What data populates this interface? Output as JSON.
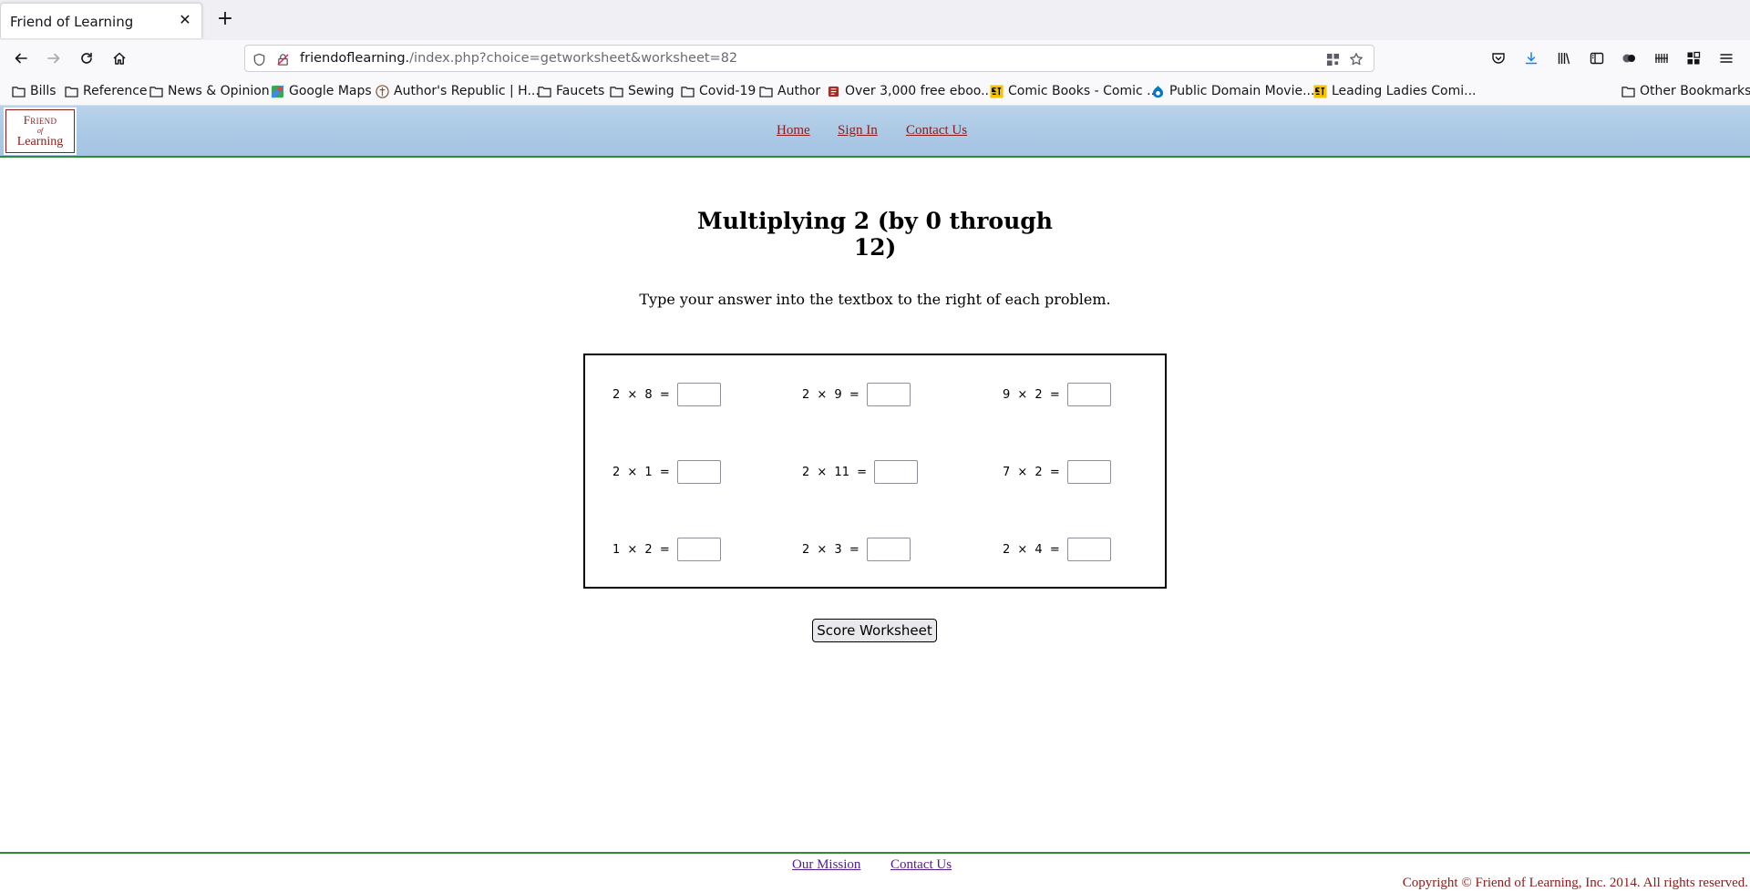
{
  "browser": {
    "tab": {
      "title": "Friend of Learning"
    },
    "url": {
      "host": "friendoflearning.",
      "path": "/index.php?choice=getworksheet&worksheet=82"
    },
    "bookmarks": [
      {
        "label": "Bills",
        "icon": "folder-icon"
      },
      {
        "label": "Reference",
        "icon": "folder-icon"
      },
      {
        "label": "News & Opinion",
        "icon": "folder-icon"
      },
      {
        "label": "Google Maps",
        "icon": "google-maps-icon"
      },
      {
        "label": "Author's Republic | H...",
        "icon": "authors-republic-icon"
      },
      {
        "label": "Faucets",
        "icon": "folder-icon"
      },
      {
        "label": "Sewing",
        "icon": "folder-icon"
      },
      {
        "label": "Covid-19",
        "icon": "folder-icon"
      },
      {
        "label": "Author",
        "icon": "folder-icon"
      },
      {
        "label": "Over 3,000 free eboo...",
        "icon": "book-icon"
      },
      {
        "label": "Comic Books - Comic ...",
        "icon": "comic-plus-icon"
      },
      {
        "label": "Public Domain Movie...",
        "icon": "drupal-icon"
      },
      {
        "label": "Leading Ladies Comi...",
        "icon": "comic-plus-icon"
      }
    ],
    "other_bookmarks": "Other Bookmarks"
  },
  "site": {
    "logo": {
      "line1": "Friend",
      "line2": "of",
      "line3": "Learning"
    },
    "nav": [
      "Home",
      "Sign In",
      "Contact Us"
    ]
  },
  "worksheet": {
    "title": "Multiplying 2 (by 0 through 12)",
    "instructions": "Type your answer into the textbox to the right of each problem.",
    "problems": [
      {
        "expr": "2 × 8 ="
      },
      {
        "expr": "2 × 9 ="
      },
      {
        "expr": "9 × 2 ="
      },
      {
        "expr": "2 × 1 ="
      },
      {
        "expr": "2 × 11 ="
      },
      {
        "expr": "7 × 2 ="
      },
      {
        "expr": "1 × 2 ="
      },
      {
        "expr": "2 × 3 ="
      },
      {
        "expr": "2 × 4 ="
      }
    ],
    "submit_label": "Score Worksheet"
  },
  "footer": {
    "links": [
      "Our Mission",
      "Contact Us"
    ],
    "copyright": "Copyright © Friend of Learning, Inc. 2014. All rights reserved."
  },
  "colors": {
    "header_blue": "#aac8e5",
    "rule_green": "#2e8b2e",
    "brand_red": "#8a1b1b",
    "visited_link": "#551a8b"
  }
}
